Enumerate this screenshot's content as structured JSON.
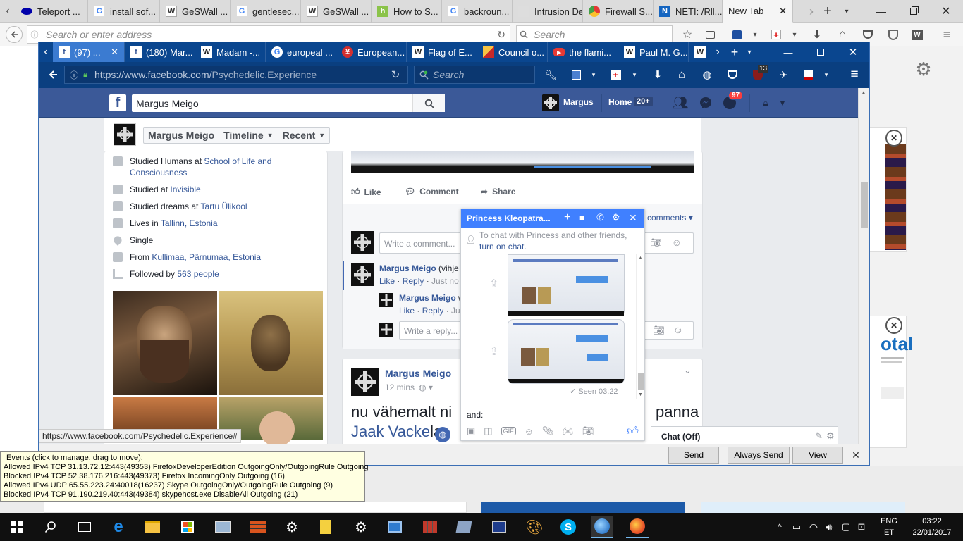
{
  "outer_tabs": [
    {
      "label": "Teleport ...",
      "icon": "teleport-icon",
      "color": "#0000aa"
    },
    {
      "label": "install sof...",
      "icon": "google-icon",
      "color": "#4285f4"
    },
    {
      "label": "GeSWall ...",
      "icon": "wikipedia-icon",
      "color": "#333333"
    },
    {
      "label": "gentlesec...",
      "icon": "google-icon",
      "color": "#4285f4"
    },
    {
      "label": "GeSWall ...",
      "icon": "wikipedia-icon",
      "color": "#333333"
    },
    {
      "label": "How to S...",
      "icon": "howto-icon",
      "color": "#8bc34a"
    },
    {
      "label": "backroun...",
      "icon": "google-icon",
      "color": "#4285f4"
    },
    {
      "label": "Intrusion Det...",
      "icon": "blank-icon",
      "color": "#dddddd"
    },
    {
      "label": "Firewall S...",
      "icon": "chrome-icon",
      "color": "#e53935"
    },
    {
      "label": "NETI: /Rll...",
      "icon": "neti-icon",
      "color": "#1565c0"
    },
    {
      "label": "New Tab",
      "icon": "",
      "color": "#f5f5f5"
    }
  ],
  "outer_address": {
    "placeholder": "Search or enter address",
    "search_placeholder": "Search"
  },
  "inner_tabs": [
    {
      "label": "(97) ...",
      "icon": "facebook-icon",
      "active": true
    },
    {
      "label": "(180) Mar...",
      "icon": "facebook-icon"
    },
    {
      "label": "Madam -...",
      "icon": "wikipedia-icon"
    },
    {
      "label": "europeal ...",
      "icon": "google-icon"
    },
    {
      "label": "European...",
      "icon": "eu-icon"
    },
    {
      "label": "Flag of E...",
      "icon": "wikipedia-icon"
    },
    {
      "label": "Council o...",
      "icon": "coat-of-arms-icon"
    },
    {
      "label": "the flami...",
      "icon": "youtube-icon"
    },
    {
      "label": "Paul M. G...",
      "icon": "wikipedia-icon"
    },
    {
      "label": "",
      "icon": "wikipedia-icon"
    }
  ],
  "inner_address": {
    "url_base": "https://www.facebook.com/",
    "url_path": "Psychedelic.Experience",
    "search_placeholder": "Search",
    "ublock_count": "13"
  },
  "fb_header": {
    "search_value": "Margus Meigo",
    "user_name": "Margus",
    "home_label": "Home",
    "home_count": "20+",
    "notif_count": "97"
  },
  "profile_nav": {
    "name": "Margus Meigo",
    "timeline": "Timeline",
    "recent": "Recent"
  },
  "intro": [
    {
      "icon": "education-icon",
      "text": "Studied Humans at ",
      "link": "School of Life and Consciousness"
    },
    {
      "icon": "education-icon",
      "text": "Studied at ",
      "link": "Invisible"
    },
    {
      "icon": "education-icon",
      "text": "Studied dreams at ",
      "link": "Tartu Ülikool"
    },
    {
      "icon": "home-icon",
      "text": "Lives in ",
      "link": "Tallinn, Estonia"
    },
    {
      "icon": "heart-icon",
      "text": "Single",
      "link": ""
    },
    {
      "icon": "pin-icon",
      "text": "From ",
      "link": "Kullimaa, Pärnumaa, Estonia"
    },
    {
      "icon": "rss-icon",
      "text": "Followed by ",
      "link": "563 people"
    }
  ],
  "post1": {
    "like": "Like",
    "comment": "Comment",
    "share": "Share",
    "comments_link": "comments",
    "write_comment": "Write a comment...",
    "c1_name": "Margus Meigo",
    "c1_text": " (vihje",
    "c1_like": "Like",
    "c1_reply": "Reply",
    "c1_time": "Just no",
    "c2_name": "Margus Meigo",
    "c2_text": " w",
    "c2_like": "Like",
    "c2_reply": "Reply",
    "c2_time": "Ju",
    "write_reply": "Write a reply..."
  },
  "post2": {
    "author": "Margus Meigo",
    "time": "12 mins",
    "text_line1_a": "nu vähemalt ni",
    "text_line1_b": "panna",
    "text_line2_link": "Jaak Vacke",
    "text_line2_rest": "la"
  },
  "chat": {
    "title": "Princess Kleopatra...",
    "notice_text": "To chat with Princess and other friends, ",
    "notice_link": "turn on chat.",
    "seen": "Seen 03:22",
    "input_value": "and:"
  },
  "chat_off": {
    "label": "Chat (Off)"
  },
  "status_url": "https://www.facebook.com/Psychedelic.Experience#",
  "send_bar": {
    "send": "Send",
    "always_send": "Always Send",
    "view": "View"
  },
  "events": {
    "title": "Events (click to manage, drag to move):",
    "lines": [
      "Allowed IPv4 TCP 31.13.72.12:443(49353) FirefoxDeveloperEdition OutgoingOnly/OutgoingRule Outgoing",
      "Blocked IPv4 TCP 52.38.176.216:443(49373) Firefox IncomingOnly Outgoing (16)",
      "Allowed IPv4 UDP 65.55.223.24:40018(16237) Skype OutgoingOnly/OutgoingRule Outgoing (9)",
      "Blocked IPv4 TCP 91.190.219.40:443(49384) skypehost.exe DisableAll Outgoing (21)"
    ]
  },
  "right_panel": {
    "text1": "otal"
  },
  "taskbar": {
    "lang1": "ENG",
    "lang2": "ET",
    "time": "03:22",
    "date": "22/01/2017"
  },
  "colors": {
    "fb_blue": "#3b5998",
    "inner_tabbar": "#0a468f",
    "chat_header": "#4080ff",
    "taskbar": "#101010"
  }
}
